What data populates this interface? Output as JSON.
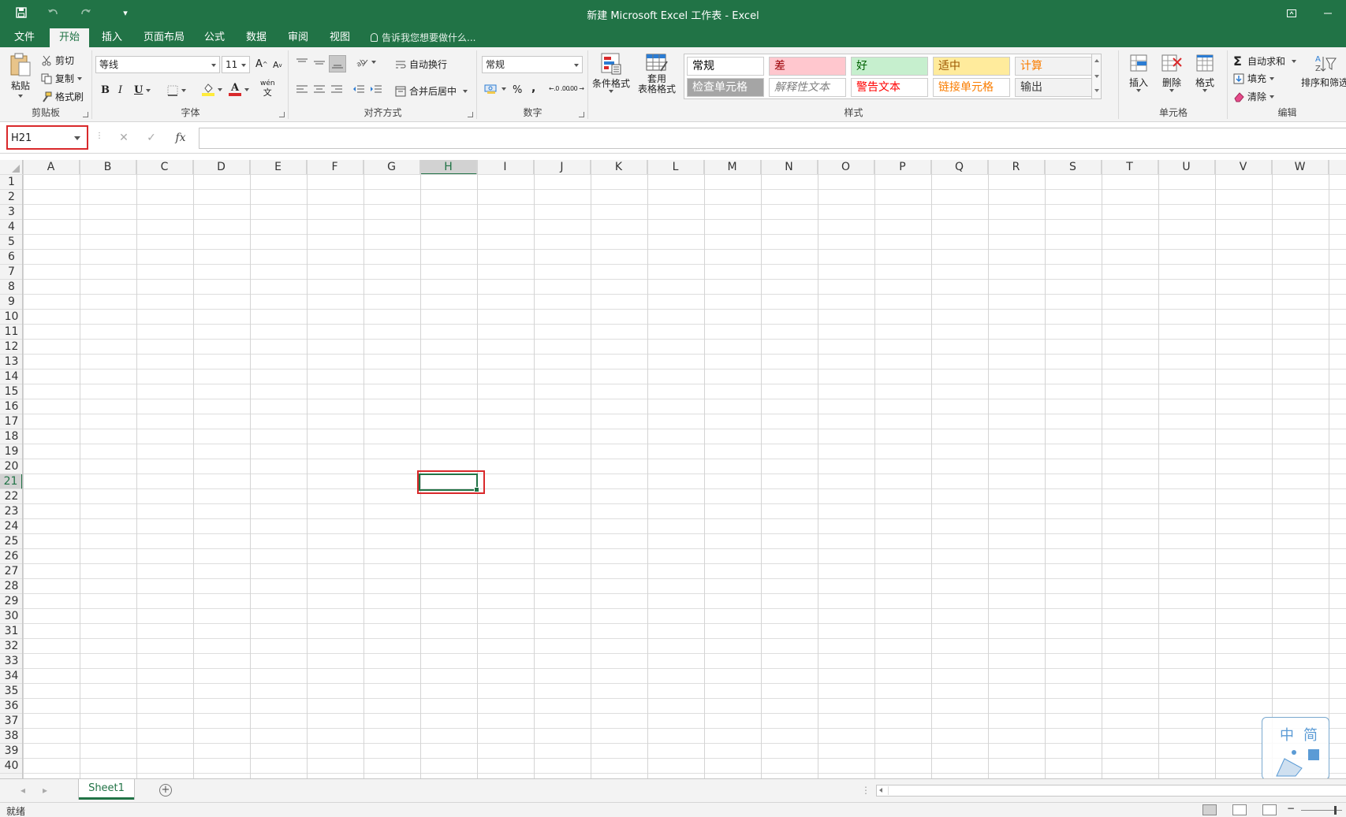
{
  "window": {
    "title": "新建 Microsoft Excel 工作表 - Excel",
    "qa_customize": "▾"
  },
  "tabs": {
    "file": "文件",
    "home": "开始",
    "insert": "插入",
    "layout": "页面布局",
    "formulas": "公式",
    "data": "数据",
    "review": "审阅",
    "view": "视图",
    "tell_me": "告诉我您想要做什么..."
  },
  "clipboard": {
    "group_label": "剪贴板",
    "paste": "粘贴",
    "cut": "剪切",
    "copy": "复制",
    "format_painter": "格式刷"
  },
  "font": {
    "group_label": "字体",
    "font_name": "等线",
    "font_size": "11",
    "grow": "A",
    "shrink": "A",
    "bold": "B",
    "italic": "I",
    "underline": "U",
    "font_color_letter": "A",
    "phonetic_top": "wén",
    "phonetic_bottom": "文",
    "font_color": "#d9292b",
    "fill_color": "#ffeb3b"
  },
  "alignment": {
    "group_label": "对齐方式",
    "wrap_text": "自动换行",
    "merge_center": "合并后居中"
  },
  "number": {
    "group_label": "数字",
    "format": "常规",
    "percent": "%",
    "comma": ",",
    "inc_decimal": "←.0 .00",
    "dec_decimal": ".00 →.0"
  },
  "styles": {
    "group_label": "样式",
    "conditional_format": "条件格式",
    "table_format_line1": "套用",
    "table_format_line2": "表格格式",
    "cells": [
      {
        "label": "常规",
        "bg": "#ffffff",
        "color": "#000000"
      },
      {
        "label": "差",
        "bg": "#ffc7ce",
        "color": "#9c0006"
      },
      {
        "label": "好",
        "bg": "#c6efce",
        "color": "#006100"
      },
      {
        "label": "适中",
        "bg": "#ffeb9c",
        "color": "#9c5700"
      },
      {
        "label": "计算",
        "bg": "#f2f2f2",
        "color": "#fa7d00"
      },
      {
        "label": "检查单元格",
        "bg": "#a5a5a5",
        "color": "#ffffff"
      },
      {
        "label": "解释性文本",
        "bg": "#ffffff",
        "color": "#7f7f7f"
      },
      {
        "label": "警告文本",
        "bg": "#ffffff",
        "color": "#ff0000"
      },
      {
        "label": "链接单元格",
        "bg": "#ffffff",
        "color": "#fa7d00"
      },
      {
        "label": "输出",
        "bg": "#f2f2f2",
        "color": "#3f3f3f"
      }
    ]
  },
  "cells_group": {
    "group_label": "单元格",
    "insert": "插入",
    "delete": "删除",
    "format": "格式"
  },
  "editing": {
    "group_label": "编辑",
    "autosum": "自动求和",
    "fill": "填充",
    "clear": "清除",
    "sort_filter": "排序和筛选"
  },
  "formula_bar": {
    "name_box": "H21",
    "cancel": "✕",
    "enter": "✓",
    "fx": "fx",
    "value": ""
  },
  "grid": {
    "columns": [
      "A",
      "B",
      "C",
      "D",
      "E",
      "F",
      "G",
      "H",
      "I",
      "J",
      "K",
      "L",
      "M",
      "N",
      "O",
      "P",
      "Q",
      "R",
      "S",
      "T",
      "U",
      "V",
      "W"
    ],
    "row_count": 40,
    "selected_column": "H",
    "selected_row": 21
  },
  "watermark": {
    "char1": "中",
    "char2": "简"
  },
  "sheets": {
    "active": "Sheet1",
    "add": "+"
  },
  "status": {
    "ready": "就绪"
  }
}
